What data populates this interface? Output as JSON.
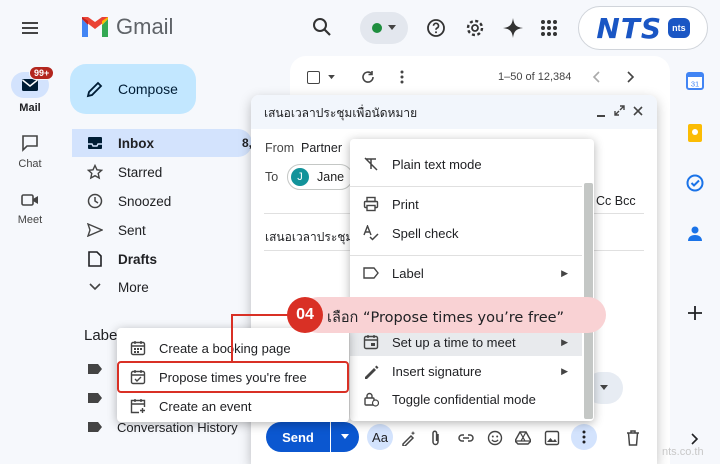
{
  "app": {
    "name": "Gmail"
  },
  "rail": {
    "mail_label": "Mail",
    "mail_badge": "99+",
    "chat_label": "Chat",
    "meet_label": "Meet"
  },
  "compose_label": "Compose",
  "nav": {
    "inbox": "Inbox",
    "inbox_count": "8,",
    "starred": "Starred",
    "snoozed": "Snoozed",
    "sent": "Sent",
    "drafts": "Drafts",
    "more": "More"
  },
  "labels_heading": "Labe",
  "labels_partial": "Conversation History",
  "list_toolbar": {
    "range": "1–50 of 12,384"
  },
  "logo": {
    "text": "NTS",
    "small": "nts"
  },
  "compose_window": {
    "title": "เสนอเวลาประชุมเพื่อนัดหมาย",
    "from_label": "From",
    "from_value": "Partner",
    "to_label": "To",
    "recipient_initial": "J",
    "recipient_name": "Jane",
    "cc_bcc": "Cc Bcc",
    "subject_partial": "เสนอเวลาประชุม",
    "send_label": "Send",
    "format_label": "Aa"
  },
  "more_menu": [
    {
      "label": "Plain text mode",
      "icon": "plain-text-icon"
    },
    {
      "label": "Print",
      "icon": "print-icon"
    },
    {
      "label": "Spell check",
      "icon": "spell-check-icon"
    },
    {
      "label": "Label",
      "icon": "label-icon"
    },
    {
      "label": "Set up a time to meet",
      "icon": "calendar-meet-icon"
    },
    {
      "label": "Insert signature",
      "icon": "signature-icon"
    },
    {
      "label": "Toggle confidential mode",
      "icon": "lock-clock-icon"
    }
  ],
  "meet_submenu": [
    {
      "label": "Create a booking page",
      "icon": "calendar-grid-icon"
    },
    {
      "label": "Propose times you're free",
      "icon": "calendar-check-icon"
    },
    {
      "label": "Create an event",
      "icon": "calendar-add-icon"
    }
  ],
  "callout": {
    "step": "04",
    "text": "เลือก “Propose times you’re free”"
  },
  "watermark": "nts.co.th",
  "colors": {
    "accent_red": "#d93025",
    "send_blue": "#0b57d0",
    "callout_bg": "#f9d2d4",
    "highlight": "#d93025"
  }
}
